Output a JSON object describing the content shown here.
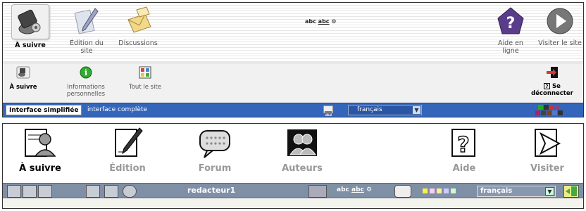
{
  "top": {
    "toolbar": {
      "items": [
        {
          "label": "À suivre",
          "icon": "wrench-icon",
          "active": true
        },
        {
          "label": "Édition du site",
          "icon": "quill-icon",
          "active": false
        },
        {
          "label": "Discussions",
          "icon": "envelope-icon",
          "active": false
        }
      ],
      "center_text": "abc",
      "right_items": [
        {
          "label": "Aide en ligne",
          "icon": "help-icon"
        },
        {
          "label": "Visiter le site",
          "icon": "play-icon"
        }
      ]
    },
    "subtoolbar": {
      "items": [
        {
          "label": "À suivre",
          "icon": "wrench-small-icon"
        },
        {
          "label": "Informations personnelles",
          "icon": "info-icon"
        },
        {
          "label": "Tout le site",
          "icon": "site-grid-icon"
        }
      ],
      "logout_label": "Se déconnecter"
    },
    "bluebar": {
      "tab_simple": "Interface simplifiée",
      "tab_complete": "interface complète",
      "language": "français"
    }
  },
  "bottom": {
    "nav": [
      {
        "label": "À suivre",
        "icon": "person-document-icon",
        "active": true
      },
      {
        "label": "Édition",
        "icon": "pen-icon",
        "active": false
      },
      {
        "label": "Forum",
        "icon": "speech-bubble-icon",
        "active": false
      },
      {
        "label": "Auteurs",
        "icon": "people-icon",
        "active": false
      },
      {
        "label": "Aide",
        "icon": "question-icon",
        "active": false
      },
      {
        "label": "Visiter",
        "icon": "arrow-visit-icon",
        "active": false
      }
    ],
    "bar": {
      "username": "redacteur1",
      "language": "français",
      "spell": "abc"
    }
  },
  "colors": {
    "blue_bar": "#3366bb",
    "gray_bar": "#7f8fa6",
    "swatches_top": [
      "#22aa22",
      "#333333",
      "#cc3333",
      "#884488",
      "#aa2266",
      "#444444",
      "#774422",
      "#5577cc"
    ],
    "swatches_bottom": [
      "#ffee44",
      "#ffccee",
      "#ffee99",
      "#ccccff",
      "#ccffcc"
    ]
  }
}
